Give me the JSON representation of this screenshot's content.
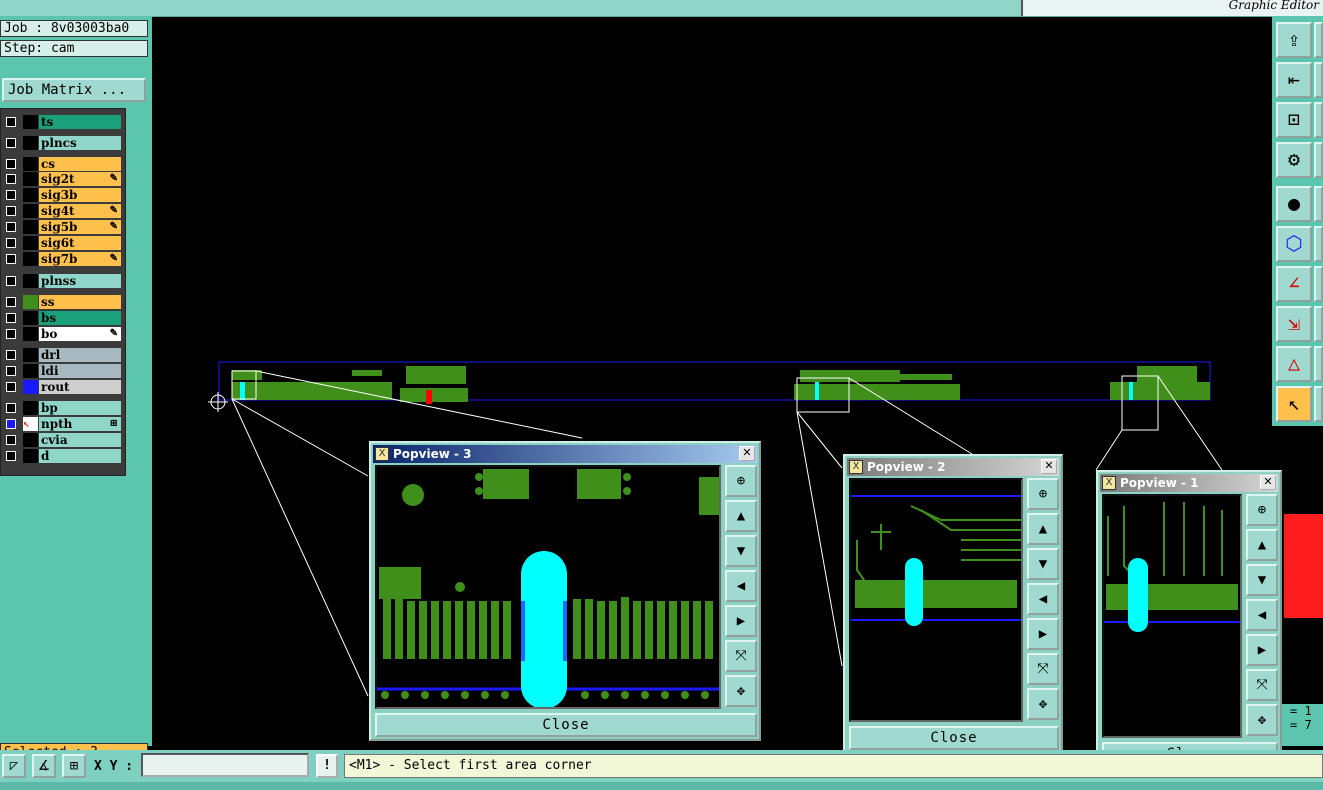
{
  "top": {
    "app_title": "Graphic Editor"
  },
  "job": {
    "job_label": "Job : 8v03003ba0",
    "step_label": "Step: cam",
    "job_matrix_button": "Job Matrix ..."
  },
  "layers": [
    {
      "name": "ts",
      "color": "#1aa07a",
      "editable": ""
    },
    {
      "name": "plncs",
      "color": "#8fd6c9",
      "editable": ""
    },
    {
      "name": "cs",
      "color": "#ffc04c",
      "editable": ""
    },
    {
      "name": "sig2t",
      "color": "#ffc04c",
      "editable": "✎"
    },
    {
      "name": "sig3b",
      "color": "#ffc04c",
      "editable": ""
    },
    {
      "name": "sig4t",
      "color": "#ffc04c",
      "editable": "✎"
    },
    {
      "name": "sig5b",
      "color": "#ffc04c",
      "editable": "✎"
    },
    {
      "name": "sig6t",
      "color": "#ffc04c",
      "editable": ""
    },
    {
      "name": "sig7b",
      "color": "#ffc04c",
      "editable": "✎"
    },
    {
      "name": "plnss",
      "color": "#8fd6c9",
      "editable": ""
    },
    {
      "name": "ss",
      "color": "#ffc04c",
      "editable": ""
    },
    {
      "name": "bs",
      "color": "#1aa07a",
      "editable": ""
    },
    {
      "name": "bo",
      "color": "#ffffff",
      "editable": "✎"
    },
    {
      "name": "drl",
      "color": "#a8b8c0",
      "editable": ""
    },
    {
      "name": "ldi",
      "color": "#a8b8c0",
      "editable": ""
    },
    {
      "name": "rout",
      "color": "#cfcfcf",
      "editable": ""
    },
    {
      "name": "bp",
      "color": "#8fd6c9",
      "editable": ""
    },
    {
      "name": "npth",
      "color": "#8fd6c9",
      "editable": "⊞"
    },
    {
      "name": "cvia",
      "color": "#8fd6c9",
      "editable": ""
    },
    {
      "name": "d",
      "color": "#8fd6c9",
      "editable": ""
    }
  ],
  "status": {
    "selected": "Selected : 3"
  },
  "bottom": {
    "xy_label": "X Y :",
    "xy_value": "",
    "prompt_button": "!",
    "prompt": "<M1> - Select first area corner"
  },
  "coords": {
    "line1": "= 1",
    "line2": "= 7"
  },
  "popups": [
    {
      "title": "Popview - 3",
      "close_label": "Close"
    },
    {
      "title": "Popview - 2",
      "close_label": "Close"
    },
    {
      "title": "Popview - 1",
      "close_label": "Close"
    }
  ],
  "colors": {
    "panel": "#5cc5ad",
    "copper": "#3f8f1a",
    "drill": "#00ffff",
    "outline": "#1a1aff",
    "highlight": "#ffc04c"
  }
}
